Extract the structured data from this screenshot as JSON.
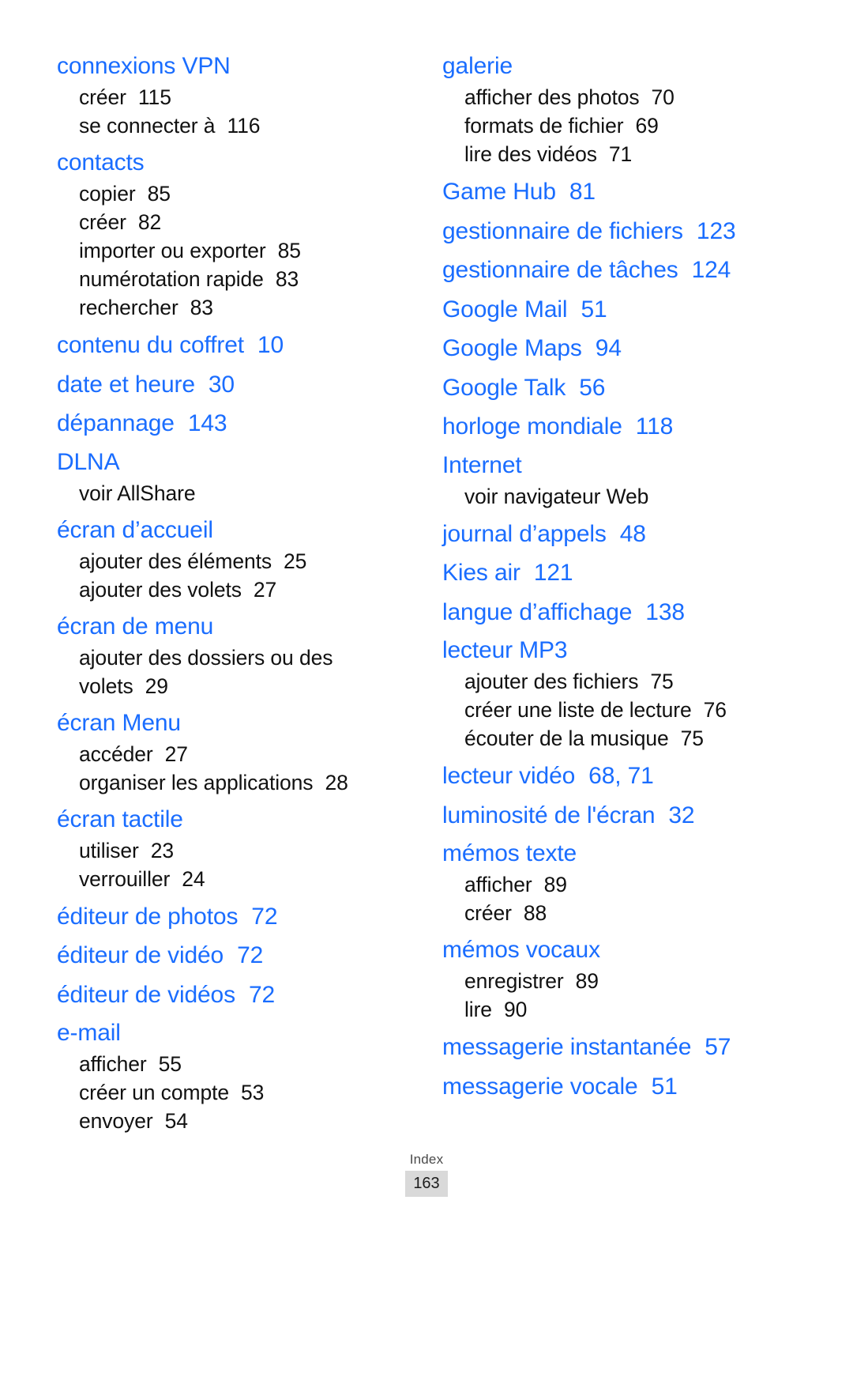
{
  "document": {
    "type": "index",
    "language": "fr",
    "footer_label": "Index",
    "page_number": "163",
    "accent_color": "#1a6dff",
    "text_color": "#111111"
  },
  "columns": [
    {
      "name": "left-column",
      "entries": [
        {
          "headword": "connexions VPN",
          "page": "",
          "subentries": [
            {
              "label": "créer",
              "page": "115"
            },
            {
              "label": "se connecter à",
              "page": "116"
            }
          ]
        },
        {
          "headword": "contacts",
          "page": "",
          "subentries": [
            {
              "label": "copier",
              "page": "85"
            },
            {
              "label": "créer",
              "page": "82"
            },
            {
              "label": "importer ou exporter",
              "page": "85"
            },
            {
              "label": "numérotation rapide",
              "page": "83"
            },
            {
              "label": "rechercher",
              "page": "83"
            }
          ]
        },
        {
          "headword": "contenu du coffret",
          "page": "10",
          "subentries": []
        },
        {
          "headword": "date et heure",
          "page": "30",
          "subentries": []
        },
        {
          "headword": "dépannage",
          "page": "143",
          "subentries": []
        },
        {
          "headword": "DLNA",
          "page": "",
          "subentries": [
            {
              "label": "voir AllShare",
              "page": ""
            }
          ]
        },
        {
          "headword": "écran d’accueil",
          "page": "",
          "subentries": [
            {
              "label": "ajouter des éléments",
              "page": "25"
            },
            {
              "label": "ajouter des volets",
              "page": "27"
            }
          ]
        },
        {
          "headword": "écran de menu",
          "page": "",
          "subentries": [
            {
              "label": "ajouter des dossiers ou des volets",
              "page": "29"
            }
          ]
        },
        {
          "headword": "écran Menu",
          "page": "",
          "subentries": [
            {
              "label": "accéder",
              "page": "27"
            },
            {
              "label": "organiser les applications",
              "page": "28"
            }
          ]
        },
        {
          "headword": "écran tactile",
          "page": "",
          "subentries": [
            {
              "label": "utiliser",
              "page": "23"
            },
            {
              "label": "verrouiller",
              "page": "24"
            }
          ]
        },
        {
          "headword": "éditeur de photos",
          "page": "72",
          "subentries": []
        },
        {
          "headword": "éditeur de vidéo",
          "page": "72",
          "subentries": []
        },
        {
          "headword": "éditeur de vidéos",
          "page": "72",
          "subentries": []
        },
        {
          "headword": "e-mail",
          "page": "",
          "subentries": [
            {
              "label": "afficher",
              "page": "55"
            },
            {
              "label": "créer un compte",
              "page": "53"
            },
            {
              "label": "envoyer",
              "page": "54"
            }
          ]
        }
      ]
    },
    {
      "name": "right-column",
      "entries": [
        {
          "headword": "galerie",
          "page": "",
          "subentries": [
            {
              "label": "afficher des photos",
              "page": "70"
            },
            {
              "label": "formats de fichier",
              "page": "69"
            },
            {
              "label": "lire des vidéos",
              "page": "71"
            }
          ]
        },
        {
          "headword": "Game Hub",
          "page": "81",
          "subentries": []
        },
        {
          "headword": "gestionnaire de fichiers",
          "page": "123",
          "subentries": []
        },
        {
          "headword": "gestionnaire de tâches",
          "page": "124",
          "subentries": []
        },
        {
          "headword": "Google Mail",
          "page": "51",
          "subentries": []
        },
        {
          "headword": "Google Maps",
          "page": "94",
          "subentries": []
        },
        {
          "headword": "Google Talk",
          "page": "56",
          "subentries": []
        },
        {
          "headword": "horloge mondiale",
          "page": "118",
          "subentries": []
        },
        {
          "headword": "Internet",
          "page": "",
          "subentries": [
            {
              "label": "voir navigateur Web",
              "page": ""
            }
          ]
        },
        {
          "headword": "journal d’appels",
          "page": "48",
          "subentries": []
        },
        {
          "headword": "Kies air",
          "page": "121",
          "subentries": []
        },
        {
          "headword": "langue d’affichage",
          "page": "138",
          "subentries": []
        },
        {
          "headword": "lecteur MP3",
          "page": "",
          "subentries": [
            {
              "label": "ajouter des fichiers",
              "page": "75"
            },
            {
              "label": "créer une liste de lecture",
              "page": "76"
            },
            {
              "label": "écouter de la musique",
              "page": "75"
            }
          ]
        },
        {
          "headword": "lecteur vidéo",
          "page": "68, 71",
          "subentries": []
        },
        {
          "headword": "luminosité de l'écran",
          "page": "32",
          "subentries": []
        },
        {
          "headword": "mémos texte",
          "page": "",
          "subentries": [
            {
              "label": "afficher",
              "page": "89"
            },
            {
              "label": "créer",
              "page": "88"
            }
          ]
        },
        {
          "headword": "mémos vocaux",
          "page": "",
          "subentries": [
            {
              "label": "enregistrer",
              "page": "89"
            },
            {
              "label": "lire",
              "page": "90"
            }
          ]
        },
        {
          "headword": "messagerie instantanée",
          "page": "57",
          "subentries": []
        },
        {
          "headword": "messagerie vocale",
          "page": "51",
          "subentries": []
        }
      ]
    }
  ]
}
